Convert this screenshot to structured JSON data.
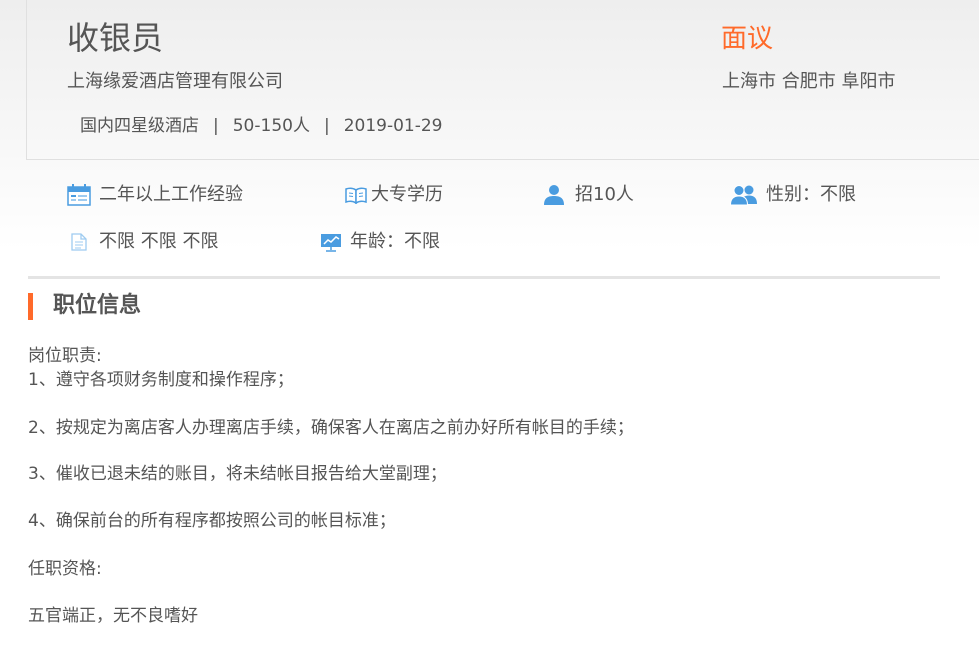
{
  "job": {
    "title": "收银员",
    "company": "上海缘爱酒店管理有限公司",
    "industry": "国内四星级酒店",
    "company_size": "50-150人",
    "date": "2019-01-29",
    "salary": "面议",
    "cities": "上海市 合肥市 阜阳市"
  },
  "requirements": {
    "experience": "二年以上工作经验",
    "education": "大专学历",
    "headcount": "招10人",
    "gender": "性别：不限",
    "other": "不限 不限 不限",
    "age": "年龄：不限"
  },
  "section": {
    "title": "职位信息"
  },
  "description": {
    "heading": "岗位职责:",
    "duty_1": "1、遵守各项财务制度和操作程序；",
    "duty_2": "2、按规定为离店客人办理离店手续，确保客人在离店之前办好所有帐目的手续；",
    "duty_3": "3、催收已退未结的账目，将未结帐目报告给大堂副理；",
    "duty_4": "4、确保前台的所有程序都按照公司的帐目标准；",
    "qualifications_heading": "任职资格:",
    "qualification_1": "五官端正，无不良嗜好"
  },
  "colors": {
    "accent": "#ff6a2a",
    "icon_blue": "#4a9ce0"
  },
  "icons": [
    "calendar-icon",
    "book-icon",
    "person-icon",
    "people-icon",
    "document-icon",
    "chart-icon"
  ]
}
